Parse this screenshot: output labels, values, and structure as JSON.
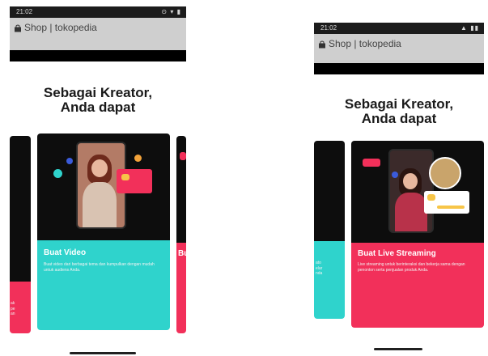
{
  "left": {
    "status_time": "21:02",
    "status_icons": "⊙ ▾ ▮",
    "site": "Shop | tokopedia",
    "headline_line1": "Sebagai Kreator,",
    "headline_line2": "Anda dapat",
    "card_title": "Buat Video",
    "card_desc": "Buat video dari berbagai tema dan kumpulkan dengan mudah untuk audiens Anda.",
    "next_card_title": "Bu",
    "peek_text": "ak\npe\nan"
  },
  "right": {
    "status_time": "21:02",
    "status_icons": "▲ ▮▮",
    "site": "Shop | tokopedia",
    "headline_line1": "Sebagai Kreator,",
    "headline_line2": "Anda dapat",
    "card_title": "Buat Live Streaming",
    "card_desc": "Live streaming untuk berinteraksi dan bekerja sama dengan penonton serta penjualan produk Anda.",
    "peek_text": "ato\nelar\nnda"
  },
  "colors": {
    "teal": "#2fd3cc",
    "pink": "#f2305a",
    "dark": "#0d0d0d"
  }
}
